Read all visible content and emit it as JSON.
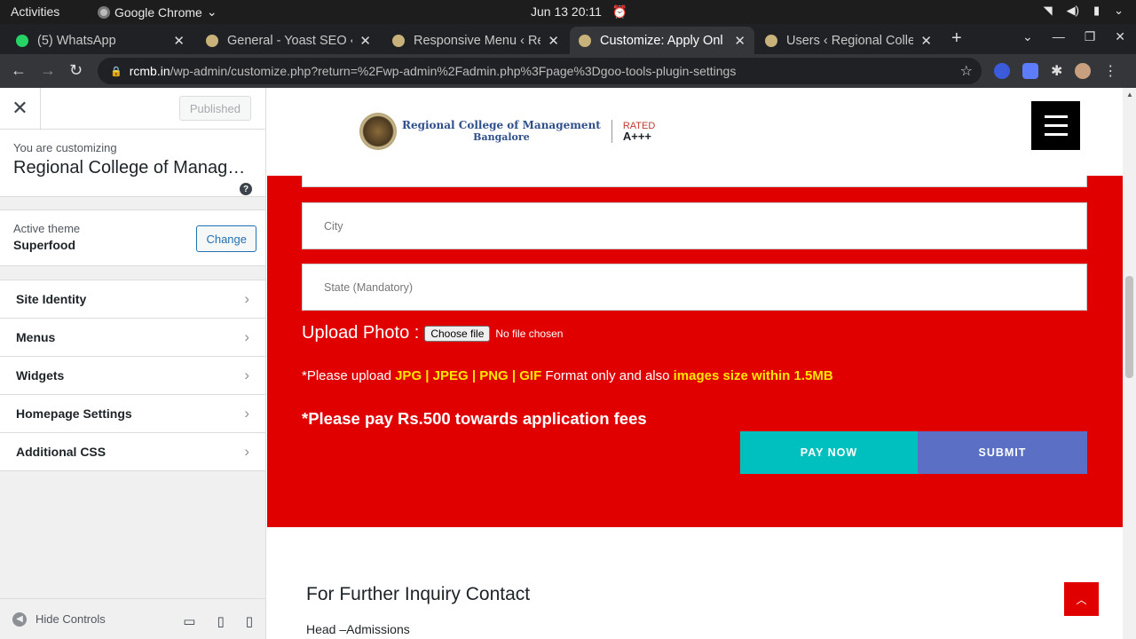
{
  "system": {
    "activities": "Activities",
    "app_name": "Google Chrome",
    "clock": "Jun 13  20:11"
  },
  "tabs": [
    {
      "title": "(5) WhatsApp",
      "active": false
    },
    {
      "title": "General - Yoast SEO ‹ R",
      "active": false
    },
    {
      "title": "Responsive Menu ‹ Re",
      "active": false
    },
    {
      "title": "Customize: Apply Onl",
      "active": true
    },
    {
      "title": "Users ‹ Regional Colle",
      "active": false
    }
  ],
  "address_bar": {
    "host": "rcmb.in",
    "path": "/wp-admin/customize.php?return=%2Fwp-admin%2Fadmin.php%3Fpage%3Dgoo-tools-plugin-settings"
  },
  "customizer": {
    "published_label": "Published",
    "customizing_label": "You are customizing",
    "site_title": "Regional College of Management Bangalore",
    "active_theme_label": "Active theme",
    "theme_name": "Superfood",
    "change_label": "Change",
    "sections": [
      "Site Identity",
      "Menus",
      "Widgets",
      "Homepage Settings",
      "Additional CSS"
    ],
    "hide_controls_label": "Hide Controls"
  },
  "preview": {
    "logo": {
      "line1": "Regional College of Management",
      "line2": "Bangalore",
      "rated": "RATED",
      "grade": "A+++"
    },
    "fields": {
      "city_placeholder": "City",
      "state_placeholder": "State (Mandatory)"
    },
    "upload": {
      "label": "Upload Photo :",
      "button": "Choose file",
      "status": "No file chosen"
    },
    "note": {
      "prefix": "*Please upload ",
      "formats": "JPG | JPEG | PNG | GIF",
      "middle": " Format only and also ",
      "size": "images size within 1.5MB"
    },
    "fees_text": "*Please pay Rs.500 towards application fees",
    "pay_now": "PAY NOW",
    "submit": "SUBMIT",
    "inquiry_heading": "For Further Inquiry Contact",
    "head_admissions": "Head –Admissions"
  },
  "colors": {
    "form_background": "#e10000",
    "pay_button": "#00bfbf",
    "submit_button": "#5b70c4",
    "highlight_text": "#ffe600"
  }
}
